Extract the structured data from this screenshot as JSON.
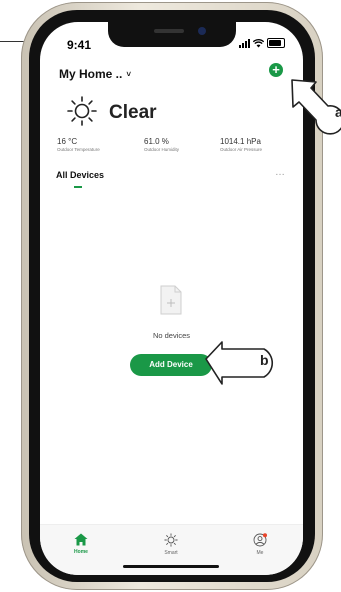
{
  "status_bar": {
    "time": "9:41"
  },
  "header": {
    "home_name": "My Home ..",
    "chevron": "˅",
    "add_symbol": "+"
  },
  "weather": {
    "condition": "Clear",
    "icon": "sun-icon",
    "stats": [
      {
        "value": "16 °C",
        "label": "Outdoor Temperature"
      },
      {
        "value": "61.0 %",
        "label": "Outdoor Humidity"
      },
      {
        "value": "1014.1 hPa",
        "label": "Outdoor Air Pressure"
      }
    ]
  },
  "devices": {
    "tab_label": "All Devices",
    "more": "…",
    "empty_text": "No devices",
    "add_button": "Add Device"
  },
  "tabbar": {
    "items": [
      {
        "label": "Home",
        "icon": "house-icon"
      },
      {
        "label": "Smart",
        "icon": "sun-outline-icon"
      },
      {
        "label": "Me",
        "icon": "profile-icon"
      }
    ]
  },
  "callouts": {
    "a": "a",
    "b": "b"
  },
  "colors": {
    "accent": "#1a9847",
    "badge": "#e8452c"
  }
}
